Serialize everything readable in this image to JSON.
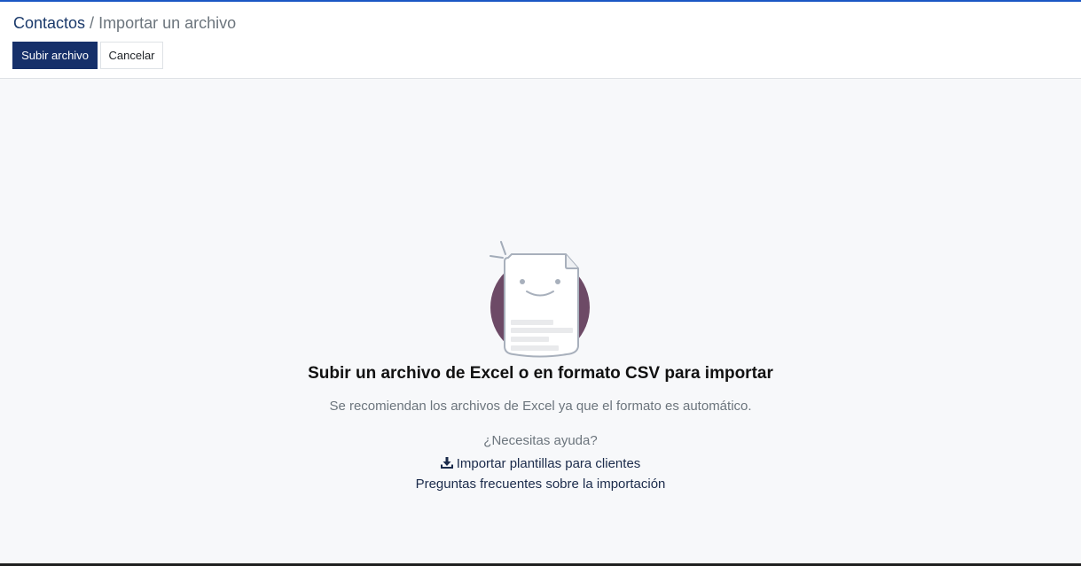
{
  "breadcrumb": {
    "parent": "Contactos",
    "separator": " / ",
    "current": "Importar un archivo"
  },
  "toolbar": {
    "upload_label": "Subir archivo",
    "cancel_label": "Cancelar"
  },
  "empty_state": {
    "illustration_icon": "smiling-document-icon",
    "title": "Subir un archivo de Excel o en formato CSV para importar",
    "subtitle": "Se recomiendan los archivos de Excel ya que el formato es automático."
  },
  "help": {
    "title": "¿Necesitas ayuda?",
    "templates_icon": "download-icon",
    "templates_label": "Importar plantillas para clientes",
    "faq_label": "Preguntas frecuentes sobre la importación"
  },
  "colors": {
    "primary": "#16306a",
    "accent_top": "#1a56c4",
    "background": "#f7f8fa",
    "circle": "#6d4a66"
  }
}
